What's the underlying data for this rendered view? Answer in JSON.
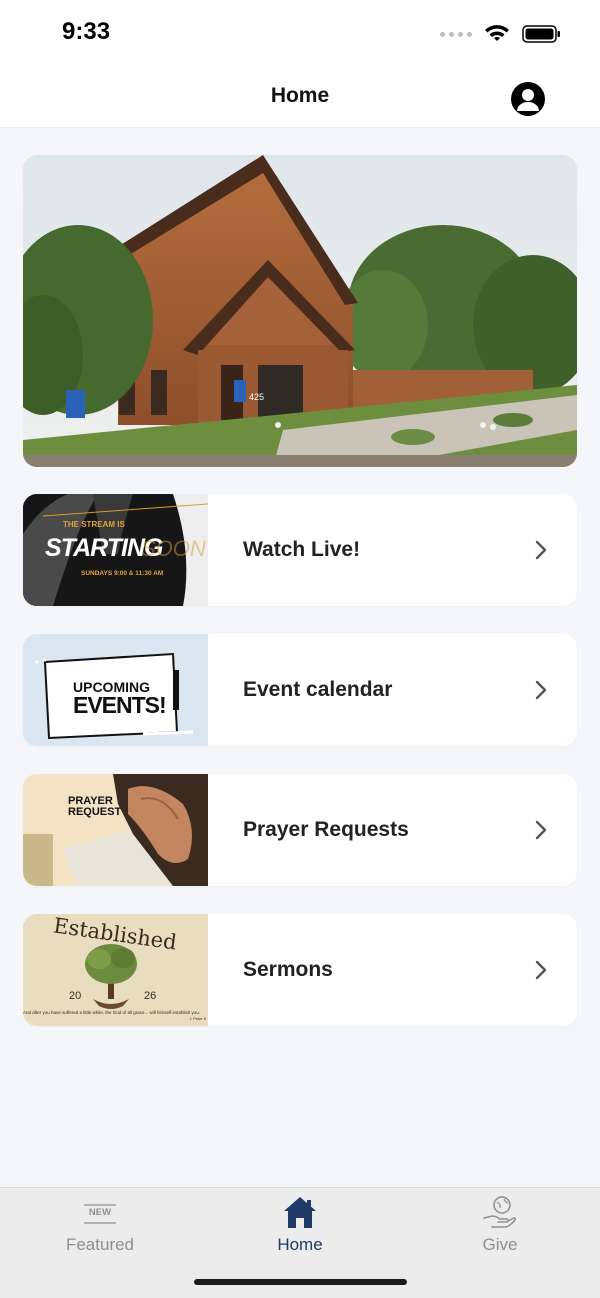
{
  "status_bar": {
    "time": "9:33"
  },
  "nav": {
    "title": "Home"
  },
  "cards": [
    {
      "label": "Watch Live!",
      "thumb_text_top": "THE STREAM IS",
      "thumb_text_main": "STARTING",
      "thumb_text_ghost": "SOON",
      "thumb_text_sub": "SUNDAYS 9:00 & 11:30 AM"
    },
    {
      "label": "Event calendar",
      "thumb_line1": "UPCOMING",
      "thumb_line2": "EVENTS!"
    },
    {
      "label": "Prayer Requests",
      "thumb_line1": "PRAYER",
      "thumb_line2": "REQUEST"
    },
    {
      "label": "Sermons",
      "thumb_title": "Established",
      "thumb_year_left": "20",
      "thumb_year_right": "26",
      "thumb_verse": "And after you have suffered a little while, the God of all grace... will himself establish you.",
      "thumb_ref": "1 Peter 5"
    }
  ],
  "hero": {
    "sign_number": "425"
  },
  "tabs": [
    {
      "label": "Featured",
      "badge": "NEW",
      "active": false
    },
    {
      "label": "Home",
      "active": true
    },
    {
      "label": "Give",
      "active": false
    }
  ],
  "colors": {
    "accent": "#1f3a66",
    "inactive": "#8e8e93",
    "background": "#f4f6fa",
    "card": "#ffffff"
  }
}
